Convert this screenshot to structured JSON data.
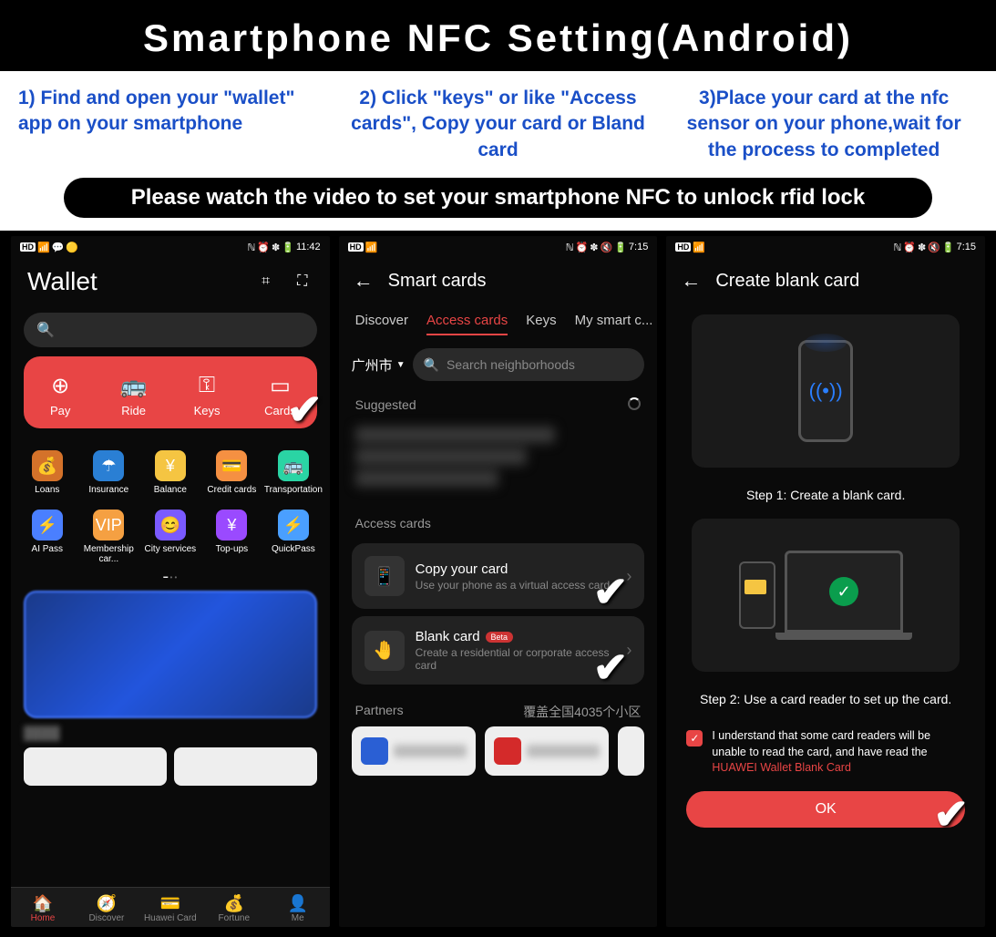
{
  "title": "Smartphone NFC Setting(Android)",
  "instructions": [
    "1) Find and open your \"wallet\" app on your smartphone",
    "2) Click \"keys\" or like \"Access cards\", Copy your card or Bland card",
    "3)Place your card at the nfc sensor on your phone,wait for the process to completed"
  ],
  "banner": "Please watch the video to set your smartphone NFC to unlock rfid lock",
  "phone1": {
    "status_time": "11:42",
    "title": "Wallet",
    "red_items": [
      {
        "icon": "¥",
        "label": "Pay"
      },
      {
        "icon": "🚌",
        "label": "Ride"
      },
      {
        "icon": "⚿",
        "label": "Keys"
      },
      {
        "icon": "💳",
        "label": "Cards"
      }
    ],
    "grid": [
      {
        "label": "Loans",
        "bg": "#d4722a"
      },
      {
        "label": "Insurance",
        "bg": "#2a7fd4"
      },
      {
        "label": "Balance",
        "bg": "#f5c542"
      },
      {
        "label": "Credit cards",
        "bg": "#f59042"
      },
      {
        "label": "Transportation",
        "bg": "#2ad4a4"
      },
      {
        "label": "AI Pass",
        "bg": "#4a7fff"
      },
      {
        "label": "Membership car...",
        "bg": "#f5a042"
      },
      {
        "label": "City services",
        "bg": "#7a5aff"
      },
      {
        "label": "Top-ups",
        "bg": "#9a4aff"
      },
      {
        "label": "QuickPass",
        "bg": "#4a9fff"
      }
    ],
    "nav": [
      {
        "label": "Home",
        "active": true
      },
      {
        "label": "Discover",
        "active": false
      },
      {
        "label": "Huawei Card",
        "active": false
      },
      {
        "label": "Fortune",
        "active": false
      },
      {
        "label": "Me",
        "active": false
      }
    ]
  },
  "phone2": {
    "status_time": "7:15",
    "title": "Smart cards",
    "tabs": [
      {
        "label": "Discover",
        "active": false
      },
      {
        "label": "Access cards",
        "active": true
      },
      {
        "label": "Keys",
        "active": false
      },
      {
        "label": "My smart c...",
        "active": false
      }
    ],
    "location": "广州市",
    "search_placeholder": "Search neighborhoods",
    "suggested_label": "Suggested",
    "access_label": "Access cards",
    "copy_card": {
      "title": "Copy your card",
      "sub": "Use your phone as a virtual access card"
    },
    "blank_card": {
      "title": "Blank card",
      "badge": "Beta",
      "sub": "Create a residential or corporate access card"
    },
    "partners_label": "Partners",
    "partners_coverage": "覆盖全国4035个小区"
  },
  "phone3": {
    "status_time": "7:15",
    "title": "Create blank card",
    "step1": "Step 1: Create a blank card.",
    "step2": "Step 2: Use a card reader to set up the card.",
    "consent_text": "I understand that some card readers will be unable to read the card, and have read the ",
    "consent_link": "HUAWEI Wallet Blank Card",
    "ok": "OK"
  }
}
